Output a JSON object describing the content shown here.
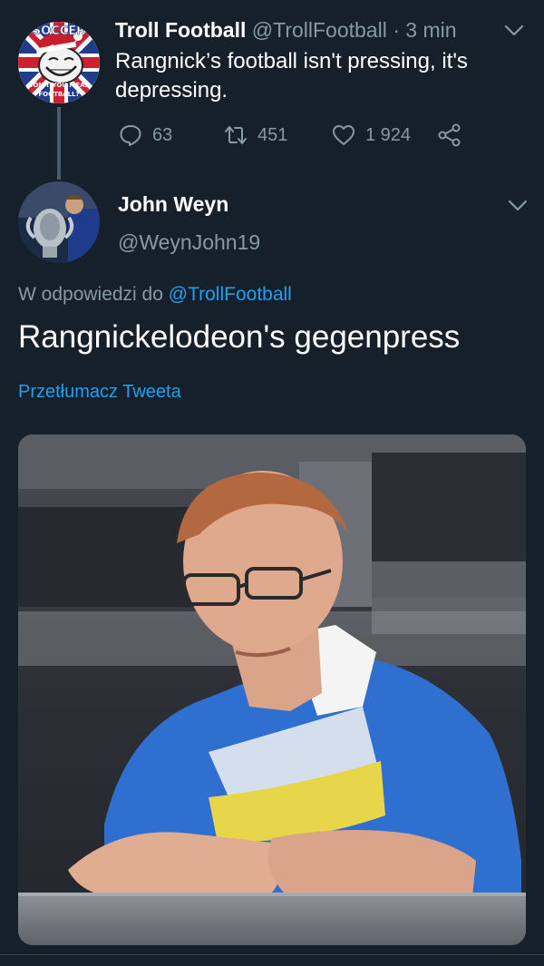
{
  "parent_tweet": {
    "author_name": "Troll Football",
    "author_handle": "@TrollFootball",
    "separator": " · ",
    "time": "3 min",
    "text": "Rangnick’s football isn't pressing, it's depressing.",
    "replies": "63",
    "retweets": "451",
    "likes": "1 924",
    "avatar_text_top": "SOCCER",
    "avatar_text_bottom_1": "DON'T YOU MEAN",
    "avatar_text_bottom_2": "FOOTBALL?"
  },
  "reply_tweet": {
    "author_name": "John Weyn",
    "author_handle": "@WeynJohn19",
    "reply_prefix": "W odpowiedzi do ",
    "reply_mention": "@TrollFootball",
    "text": "Rangnickelodeon's gegenpress",
    "translate_link": "Przetłumacz Tweeta"
  },
  "colors": {
    "background": "#15202b",
    "text_primary": "#ffffff",
    "text_secondary": "#8899a6",
    "link": "#1da1f2",
    "jersey_blue": "#2f6fd0",
    "jersey_yellow": "#e8d64a"
  },
  "icons": {
    "reply": "reply-icon",
    "retweet": "retweet-icon",
    "like": "heart-icon",
    "share": "share-icon",
    "more": "chevron-down-icon"
  }
}
